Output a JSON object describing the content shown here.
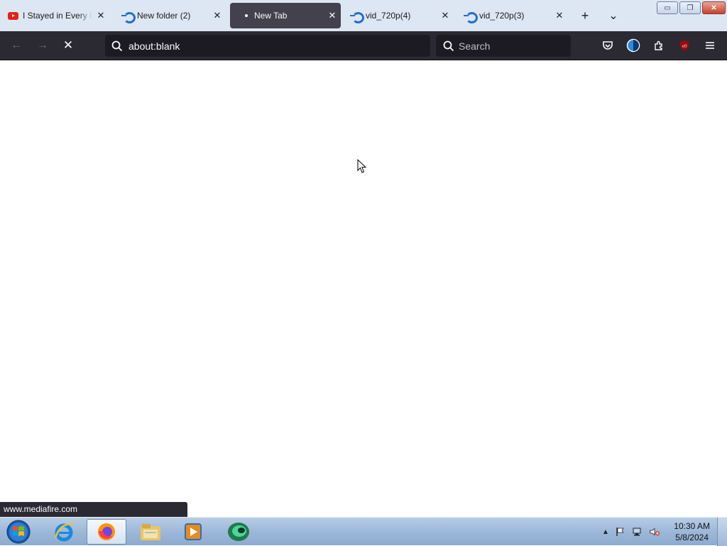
{
  "tabs": [
    {
      "title": "I Stayed in Every Ho",
      "icon": "youtube-icon",
      "active": false
    },
    {
      "title": "New folder (2)",
      "icon": "mediafire-icon",
      "active": false
    },
    {
      "title": "New Tab",
      "icon": "loading-dot-icon",
      "active": true
    },
    {
      "title": "vid_720p(4)",
      "icon": "mediafire-icon",
      "active": false
    },
    {
      "title": "vid_720p(3)",
      "icon": "mediafire-icon",
      "active": false
    }
  ],
  "tab_close_glyph": "✕",
  "new_tab_glyph": "+",
  "tab_list_glyph": "⌄",
  "window_controls": {
    "minimize": "▭",
    "restore": "❐",
    "close": "✕"
  },
  "navbar": {
    "back_glyph": "←",
    "forward_glyph": "→",
    "stop_glyph": "✕",
    "url": "about:blank",
    "search_placeholder": "Search"
  },
  "status_text": "www.mediafire.com",
  "taskbar": {
    "items": [
      "start-orb",
      "internet-explorer",
      "firefox",
      "file-explorer",
      "media-player",
      "app-green"
    ],
    "active": "firefox",
    "time": "10:30 AM",
    "date": "5/8/2024"
  },
  "colors": {
    "tabstrip": "#dde6f3",
    "active_tab": "#42414d",
    "navbar": "#2b2a33",
    "urlbar": "#1c1b22",
    "accent_blue": "#1f6fd1",
    "youtube_red": "#e62117"
  }
}
